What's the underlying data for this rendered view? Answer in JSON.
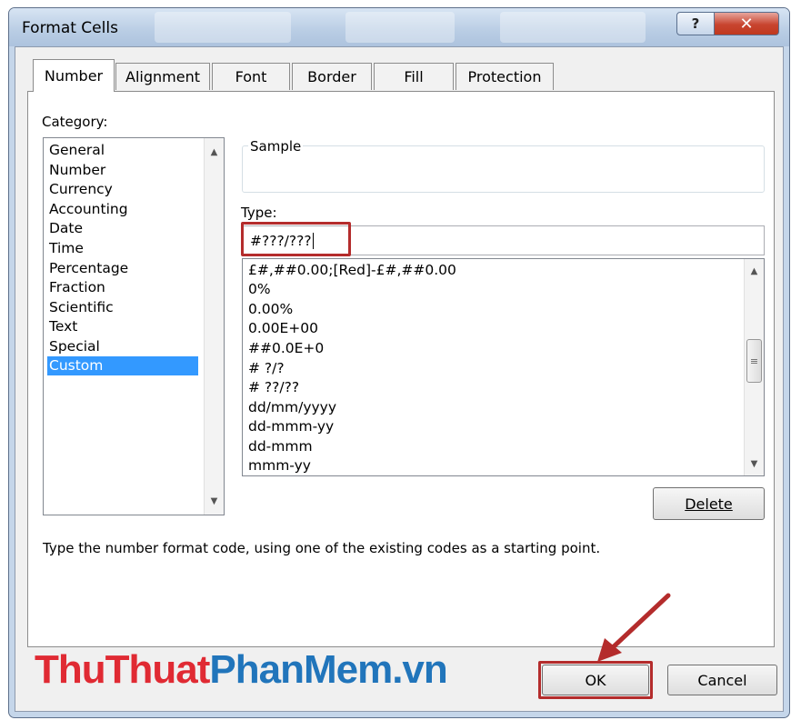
{
  "window": {
    "title": "Format Cells",
    "help_label": "?",
    "close_label": "✕"
  },
  "tabs": [
    {
      "label": "Number",
      "active": true
    },
    {
      "label": "Alignment"
    },
    {
      "label": "Font"
    },
    {
      "label": "Border"
    },
    {
      "label": "Fill"
    },
    {
      "label": "Protection"
    }
  ],
  "category": {
    "label": "Category:",
    "items": [
      "General",
      "Number",
      "Currency",
      "Accounting",
      "Date",
      "Time",
      "Percentage",
      "Fraction",
      "Scientific",
      "Text",
      "Special",
      "Custom"
    ],
    "selected": "Custom"
  },
  "sample": {
    "label": "Sample",
    "value": ""
  },
  "type": {
    "label": "Type:",
    "value": "#???/???",
    "formats": [
      "£#,##0.00;[Red]-£#,##0.00",
      "0%",
      "0.00%",
      "0.00E+00",
      "##0.0E+0",
      "# ?/?",
      "# ??/??",
      "dd/mm/yyyy",
      "dd-mmm-yy",
      "dd-mmm",
      "mmm-yy"
    ]
  },
  "buttons": {
    "delete": "Delete",
    "ok": "OK",
    "cancel": "Cancel"
  },
  "hint": "Type the number format code, using one of the existing codes as a starting point.",
  "watermark": {
    "part1": "ThuThuat",
    "part2": "PhanMem.vn"
  },
  "colors": {
    "selection": "#3399ff",
    "highlight_box": "#b42c2c",
    "watermark_red": "#e02a33",
    "watermark_blue": "#2175bb"
  }
}
